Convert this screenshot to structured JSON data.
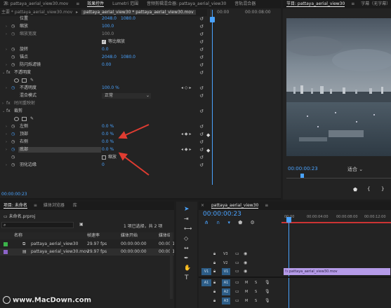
{
  "source_tab": {
    "label": "源: pattaya_aerial_view30.mov"
  },
  "tabs": [
    {
      "label": "效果控件",
      "active": true
    },
    {
      "label": "Lumetri 范围",
      "active": false
    },
    {
      "label": "音频剪辑混合器: pattaya_aerial_view30",
      "active": false
    },
    {
      "label": "音轨混合器",
      "active": false
    }
  ],
  "clip_path": {
    "master": "主要 * pattaya_aerial_view30.mov",
    "clip": "pattaya_aerial_view30 * pattaya_aerial_view30.mov"
  },
  "mini_ruler": {
    "left": "00:00",
    "right": "00:00:08:00"
  },
  "effects": {
    "position": {
      "label": "位置",
      "x": "2048.0",
      "y": "1080.0"
    },
    "scale": {
      "label": "缩放",
      "value": "100.0"
    },
    "scale_width": {
      "label": "缩放宽度",
      "value": "100.0"
    },
    "uniform_scale": {
      "label": "等比缩放"
    },
    "rotation": {
      "label": "旋转",
      "value": "0.0"
    },
    "anchor": {
      "label": "锚点",
      "x": "2048.0",
      "y": "1080.0"
    },
    "anti_flicker": {
      "label": "防闪烁滤镜",
      "value": "0.00"
    },
    "opacity": {
      "label": "不透明度",
      "sub": "不透明度",
      "value": "100.0 %"
    },
    "blend_mode": {
      "label": "混合模式",
      "value": "正常"
    },
    "time_remap": {
      "label": "时间重映射"
    },
    "crop": {
      "label": "裁剪",
      "left": {
        "label": "左侧",
        "value": "0.0 %"
      },
      "top": {
        "label": "顶部",
        "value": "0.0 %"
      },
      "right": {
        "label": "右侧",
        "value": "0.0 %"
      },
      "bottom": {
        "label": "底部",
        "value": "0.0 %"
      },
      "zoom": {
        "label": "缩放"
      },
      "feather": {
        "label": "羽化边缘",
        "value": "0"
      }
    },
    "timecode": "00:00:00:23"
  },
  "program": {
    "tab": "节目: pattaya_aerial_view30",
    "caption_tab": "字幕（无字幕）",
    "timecode": "00:00:00:23",
    "fit": "适合"
  },
  "project": {
    "tabs": [
      "项目: 未命名",
      "媒体浏览器",
      "库"
    ],
    "file": "未命名.prproj",
    "selection": "1 项已选择，共 2 项",
    "columns": [
      "名称",
      "帧速率",
      "媒体开始",
      "媒体结"
    ],
    "rows": [
      {
        "name": "pattaya_aerial_view30",
        "fps": "29.97 fps",
        "start": "00:00:00:00",
        "end": "00:00:1",
        "color": "#3bb34a"
      },
      {
        "name": "pattaya_aerial_view30.mov",
        "fps": "29.97 fps",
        "start": "00:00:00:00",
        "end": "00:00:1",
        "color": "#8c63c8"
      }
    ]
  },
  "timeline": {
    "tab": "pattaya_aerial_view30",
    "timecode": "00:00:00:23",
    "ruler": [
      "00:00",
      "00:00:04:00",
      "00:00:08:00",
      "00:00:12:00"
    ],
    "tracks_video": [
      "V3",
      "V2",
      "V1"
    ],
    "tracks_audio": [
      "A1",
      "A2",
      "A3"
    ],
    "source_v": "V1",
    "source_a": "A1",
    "clip_label": "pattaya_aerial_view30.mov",
    "toggle_m": "M",
    "toggle_s": "S"
  },
  "watermark": "www.MacDown.com",
  "colors": {
    "accent": "#4aa3ff",
    "clip": "#b59be8",
    "playhead": "#4aa3ff",
    "arrow": "#e03c31"
  }
}
